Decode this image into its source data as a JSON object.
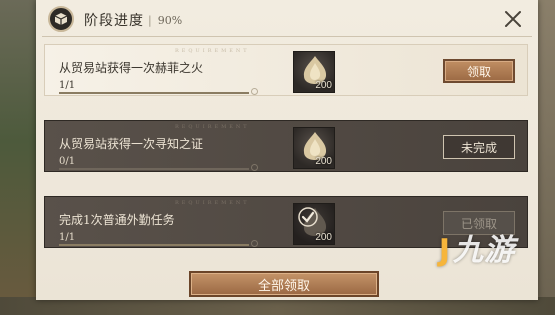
{
  "header": {
    "title": "阶段进度",
    "progress": "90%"
  },
  "watermark": "REQUIREMENT",
  "tasks": [
    {
      "name": "从贸易站获得一次赫菲之火",
      "count": "1/1",
      "fraction": 1,
      "reward_icon": "flame-crystal-icon",
      "reward_qty": "200",
      "button": "领取",
      "state": "claimable"
    },
    {
      "name": "从贸易站获得一次寻知之证",
      "count": "0/1",
      "fraction": 0,
      "reward_icon": "flame-crystal-icon",
      "reward_qty": "200",
      "button": "未完成",
      "state": "incomplete"
    },
    {
      "name": "完成1次普通外勤任务",
      "count": "1/1",
      "fraction": 1,
      "reward_icon": "claimed-check-icon",
      "reward_qty": "200",
      "button": "已领取",
      "state": "claimed"
    }
  ],
  "footer": {
    "claim_all": "全部领取"
  },
  "logo": {
    "text": "九游",
    "mark": "J"
  },
  "colors": {
    "claim_button": "#b07a52",
    "panel": "#f2ece0",
    "dark_row": "#524a43"
  }
}
